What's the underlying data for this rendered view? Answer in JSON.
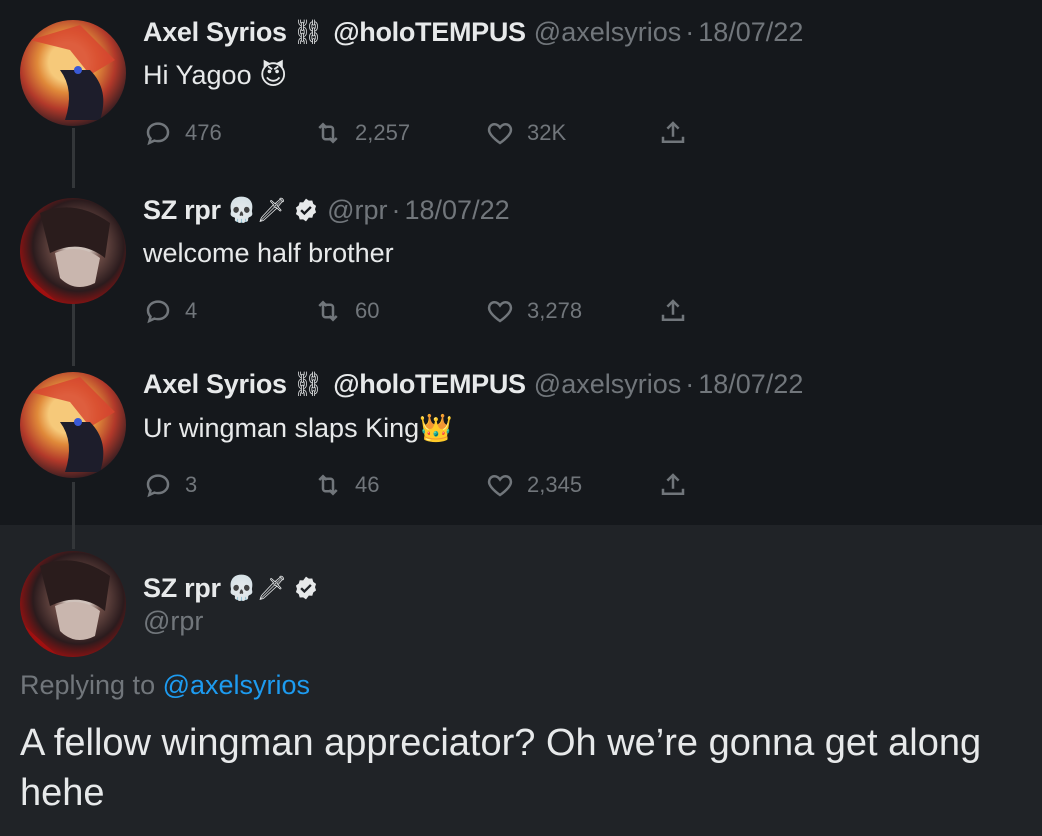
{
  "tweets": [
    {
      "name": "Axel Syrios",
      "name_emoji": "⛓",
      "name_suffix": "@holoTEMPUS",
      "handle": "@axelsyrios",
      "date": "18/07/22",
      "text": "Hi Yagoo 😈",
      "replies": "476",
      "retweets": "2,257",
      "likes": "32K"
    },
    {
      "name": "SZ rpr",
      "name_emoji": "💀🗡",
      "handle": "@rpr",
      "date": "18/07/22",
      "text": "welcome half brother",
      "replies": "4",
      "retweets": "60",
      "likes": "3,278"
    },
    {
      "name": "Axel Syrios",
      "name_emoji": "⛓",
      "name_suffix": "@holoTEMPUS",
      "handle": "@axelsyrios",
      "date": "18/07/22",
      "text": "Ur wingman slaps King👑",
      "replies": "3",
      "retweets": "46",
      "likes": "2,345"
    }
  ],
  "focus": {
    "name": "SZ rpr",
    "name_emoji": "💀🗡",
    "handle": "@rpr",
    "replying_prefix": "Replying to",
    "replying_to": "@axelsyrios",
    "text": "A fellow wingman appreciator? Oh we’re gonna get along hehe"
  },
  "colors": {
    "thread_bg": "#15181c",
    "focus_bg": "#202327",
    "text": "#e7e9ea",
    "muted": "#71767b",
    "link": "#1d9bf0"
  }
}
